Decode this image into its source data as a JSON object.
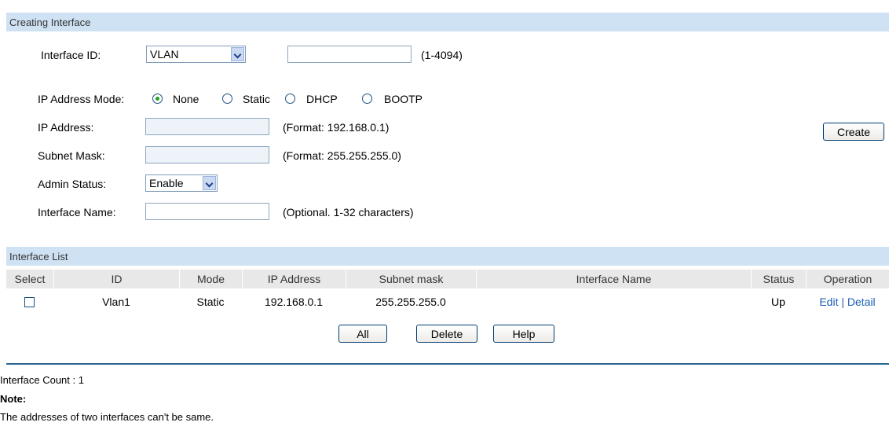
{
  "create_section": {
    "title": "Creating Interface",
    "interface_id_label": "Interface ID:",
    "interface_type": "VLAN",
    "interface_id_value": "",
    "interface_id_hint": "(1-4094)",
    "ip_mode_label": "IP Address Mode:",
    "ip_modes": [
      "None",
      "Static",
      "DHCP",
      "BOOTP"
    ],
    "ip_mode_selected": "None",
    "ip_address_label": "IP Address:",
    "ip_address_hint": "(Format: 192.168.0.1)",
    "subnet_mask_label": "Subnet Mask:",
    "subnet_mask_hint": "(Format: 255.255.255.0)",
    "admin_status_label": "Admin Status:",
    "admin_status": "Enable",
    "interface_name_label": "Interface Name:",
    "interface_name_hint": "(Optional. 1-32 characters)",
    "create_label": "Create"
  },
  "list_section": {
    "title": "Interface List",
    "columns": [
      "Select",
      "ID",
      "Mode",
      "IP Address",
      "Subnet mask",
      "Interface Name",
      "Status",
      "Operation"
    ],
    "rows": [
      {
        "id": "Vlan1",
        "mode": "Static",
        "ip": "192.168.0.1",
        "mask": "255.255.255.0",
        "name": "",
        "status": "Up",
        "edit": "Edit",
        "sep": "|",
        "detail": "Detail"
      }
    ],
    "buttons": {
      "all": "All",
      "delete": "Delete",
      "help": "Help"
    }
  },
  "footer": {
    "count": "Interface Count : 1",
    "note_title": "Note:",
    "note_text": "The addresses of two interfaces can't be same."
  },
  "colors": {
    "section_bar": "#cfe2f3",
    "header_cell": "#e8e8e8",
    "link": "#1f5fb5",
    "rule": "#2a6592"
  }
}
